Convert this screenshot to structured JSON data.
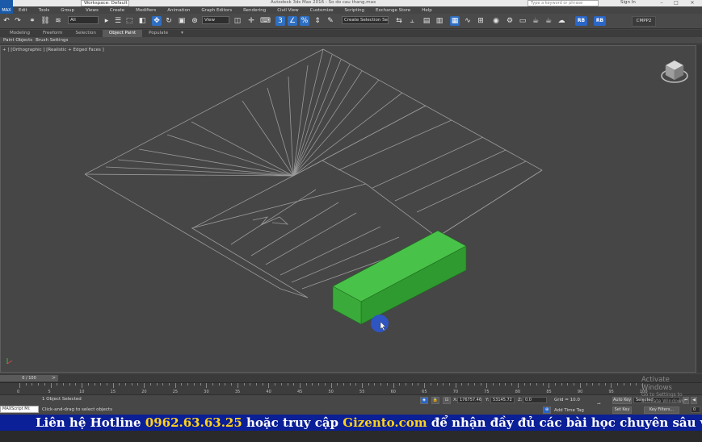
{
  "titlebar": {
    "workspace": "Workspace: Default",
    "title": "Autodesk 3ds Max 2016 - So do cau thang.max",
    "search_placeholder": "Type a keyword or phrase",
    "signin": "Sign In",
    "minimize": "–",
    "maximize": "□",
    "close": "×"
  },
  "appicon_label": "MAX",
  "menubar": [
    "Edit",
    "Tools",
    "Group",
    "Views",
    "Create",
    "Modifiers",
    "Animation",
    "Graph Editors",
    "Rendering",
    "Civil View",
    "Customize",
    "Scripting",
    "Exchange Store",
    "Help"
  ],
  "toolbar": {
    "selection_filter": "All",
    "ref_coord": "View",
    "named_selection": "Create Selection Se",
    "rb1": "RB",
    "rb2": "RB",
    "cmpp": "CMPP2"
  },
  "ribbon_tabs": [
    "Modeling",
    "Freeform",
    "Selection",
    "Object Paint",
    "Populate"
  ],
  "ribbon_active": "Object Paint",
  "subribbon": [
    "Paint Objects",
    "Brush Settings"
  ],
  "viewport": {
    "label": "+ ] [Orthographic ] [Realistic + Edged Faces ]",
    "box_color": "#3ab83a",
    "wire_color": "#9a9a9a"
  },
  "timeslider": {
    "frame": "0 / 100",
    "arrow": ">"
  },
  "trackbar_numbers": [
    "0",
    "5",
    "10",
    "15",
    "20",
    "25",
    "30",
    "35",
    "40",
    "45",
    "50",
    "55",
    "60",
    "65",
    "70",
    "75",
    "80",
    "85",
    "90",
    "95",
    "100"
  ],
  "status": {
    "maxscript": "MAXScript Mi:",
    "objects_selected": "1 Object Selected",
    "prompt": "Click-and-drag to select objects",
    "x_label": "X:",
    "x_value": "176757.46",
    "y_label": "Y:",
    "y_value": "53145.72",
    "z_label": "Z:",
    "z_value": "0.0",
    "grid": "Grid = 10.0",
    "add_time_tag": "Add Time Tag",
    "auto_key": "Auto Key",
    "set_key": "Set Key",
    "selected": "Selected",
    "key_filters": "Key Filters...",
    "frame_field": "0"
  },
  "activate": {
    "line1": "Activate Windows",
    "line2": "Go to Settings to activate Windows."
  },
  "banner": {
    "part1": "Liên hệ Hotline ",
    "hotline": "0962.63.63.25",
    "part2": " hoặc truy cập ",
    "site": "Gizento.com",
    "part3": " để nhận đầy đủ các bài học chuyên sâu và tài liệu về khóa học"
  }
}
